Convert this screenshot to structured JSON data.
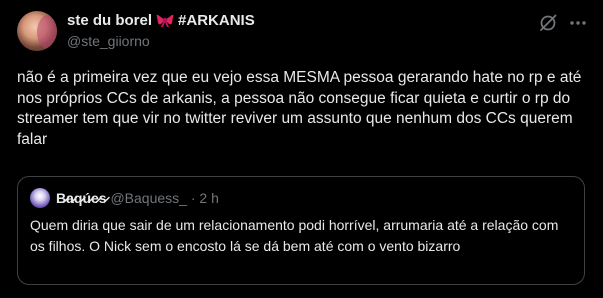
{
  "post": {
    "author": {
      "display_name": "ste du borel",
      "name_suffix": "#ARKANIS",
      "emoji_icon": "ribbon-bow-icon",
      "handle": "@ste_giiorno"
    },
    "text": "não é a primeira vez que eu vejo essa MESMA pessoa gerarando hate no rp e até nos próprios CCs de arkanis, a pessoa não consegue ficar quieta e curtir o rp do streamer tem que vir no twitter reviver um assunto que nenhum dos CCs querem falar",
    "actions": {
      "grok_icon": "grok-icon",
      "more_icon": "more-icon"
    }
  },
  "quoted_post": {
    "author": {
      "display_name": "B̷a̷q̷ú̷e̷s̷",
      "handle": "@Baquess_",
      "separator": "·",
      "time": "2 h"
    },
    "text": "Quem diria que sair de um relacionamento podi horrível, arrumaria até a relação com os filhos. O Nick sem o encosto lá se dá bem até com o vento bizarro"
  },
  "colors": {
    "background": "#000000",
    "text_primary": "#e7e9ea",
    "text_secondary": "#71767b",
    "border": "#3e4144",
    "bow": "#e0245e"
  }
}
